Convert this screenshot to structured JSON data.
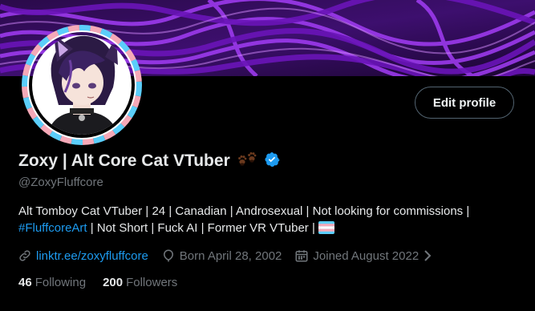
{
  "profile": {
    "display_name": "Zoxy | Alt Core Cat VTuber",
    "handle": "@ZoxyFluffcore",
    "edit_profile_label": "Edit profile",
    "verified_icon": "verified-badge-icon",
    "name_emoji_icon": "paw-prints-icon",
    "bio": {
      "text1": "Alt Tomboy Cat VTuber | 24 | Canadian | Androsexual | Not looking for commissions | ",
      "hashtag": "#FluffcoreArt",
      "text2": " | Not Short | Fuck AI | Former VR VTuber | ",
      "flag_icon": "transgender-flag-icon"
    },
    "meta": {
      "link": "linktr.ee/zoxyfluffcore",
      "born": "Born April 28, 2002",
      "joined": "Joined August 2022"
    },
    "stats": {
      "following_count": "46",
      "following_label": "Following",
      "followers_count": "200",
      "followers_label": "Followers"
    }
  },
  "colors": {
    "background": "#000000",
    "accent": "#1d9bf0",
    "secondary_text": "#71767b",
    "banner_purple": "#7a1fd1"
  }
}
